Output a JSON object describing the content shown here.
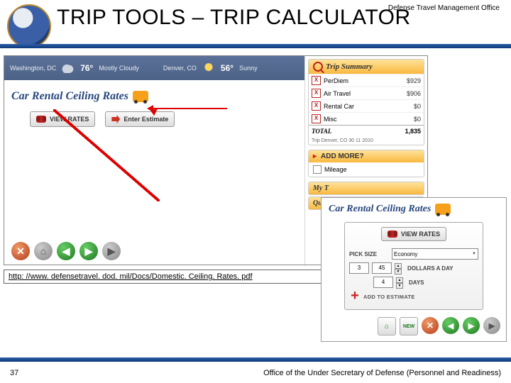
{
  "header": {
    "org": "Defense Travel Management Office",
    "title": "TRIP TOOLS – TRIP CALCULATOR"
  },
  "weather": {
    "city1": "Washington, DC",
    "temp1": "76°",
    "cond1": "Mostly Cloudy",
    "city2": "Denver, CO",
    "temp2": "56°",
    "cond2": "Sunny"
  },
  "section": {
    "car_rental_title": "Car Rental Ceiling Rates",
    "view_rates": "VIEW RATES",
    "enter_estimate": "Enter Estimate"
  },
  "trip_summary": {
    "title": "Trip Summary",
    "rows": [
      {
        "label": "PerDiem",
        "value": "$929"
      },
      {
        "label": "Air Travel",
        "value": "$906"
      },
      {
        "label": "Rental Car",
        "value": "$0"
      },
      {
        "label": "Misc",
        "value": "$0"
      }
    ],
    "total_label": "TOTAL",
    "total_value": "1,835",
    "meta": "Trip Denver, CO  30 11 2010"
  },
  "add_more": {
    "title": "ADD MORE?",
    "opt1": "Mileage"
  },
  "tabs": {
    "myt": "My T",
    "quick": "Quick"
  },
  "link": {
    "url": "http: //www. defensetravel. dod. mil/Docs/Domestic. Ceiling. Rates. pdf"
  },
  "popup": {
    "title": "Car Rental Ceiling Rates",
    "view_rates": "VIEW RATES",
    "pick_size_label": "PICK SIZE",
    "pick_size_value": "Economy",
    "dollars_label": "DOLLARS A DAY",
    "dollars_value": "45",
    "dollars_idx": "3",
    "days_label": "DAYS",
    "days_value": "4",
    "add_est": "ADD TO ESTIMATE"
  },
  "footer": {
    "page": "37",
    "org": "Office of the Under Secretary of Defense (Personnel and Readiness)"
  }
}
